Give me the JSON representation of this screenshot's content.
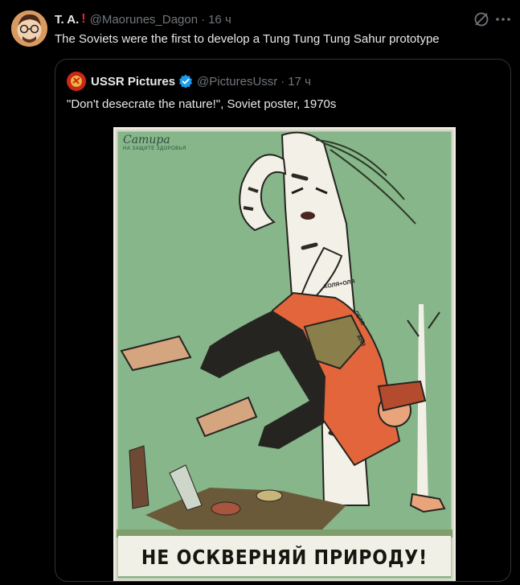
{
  "tweet": {
    "author_name": "T. A.",
    "badge_mark": "!",
    "handle": "@Maorunes_Dagon",
    "separator": "·",
    "time": "16 ч",
    "text": "The Soviets were the first to develop a  Tung Tung Tung Sahur prototype",
    "actions": {
      "grok_icon": "grok-icon",
      "more_icon": "more-icon"
    }
  },
  "quote": {
    "author_name": "USSR Pictures",
    "verified_icon": "verified-badge-icon",
    "handle": "@PicturesUssr",
    "separator": "·",
    "time": "17 ч",
    "text": "\"Don't desecrate the nature!\", Soviet poster, 1970s",
    "poster": {
      "caption": "НЕ ОСКВЕРНЯЙ ПРИРОДУ!",
      "corner_title": "Сатира",
      "corner_subtitle": "НА ЗАЩИТЕ ЗДОРОВЬЯ",
      "tree_carvings": [
        "КОЛЯ+ОЛЯ",
        "ПЕТЯ",
        "АНЯ"
      ]
    }
  },
  "colors": {
    "background": "#000000",
    "primary_text": "#e7e9ea",
    "secondary_text": "#71767b",
    "border": "#2f3336",
    "verified_blue": "#1d9bf0",
    "alert_red": "#f4212e",
    "poster_green": "#86b68a"
  }
}
